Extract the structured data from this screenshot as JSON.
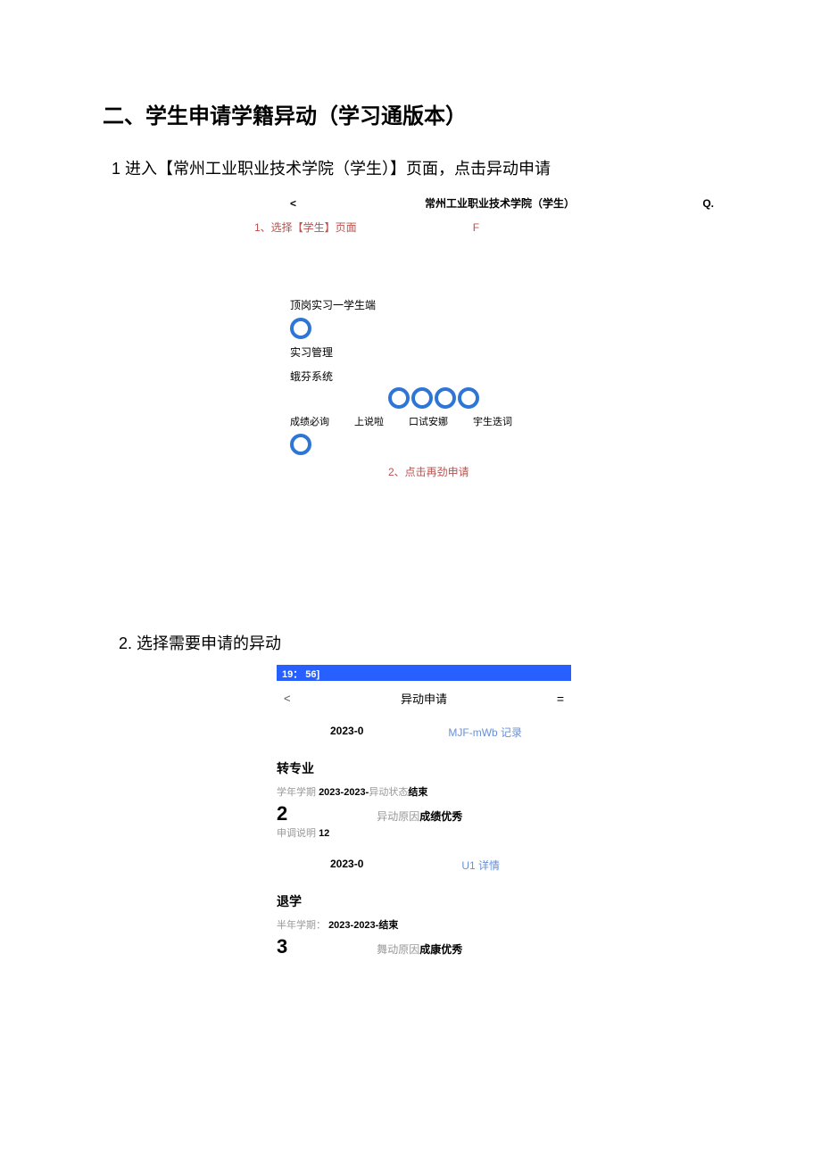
{
  "doc": {
    "heading": "二、学生申请学籍异动（学习通版本）",
    "step1": "1 进入【常州工业职业技术学院（学生）】页面，点击异动申请",
    "step2": "2. 选择需要申请的异动"
  },
  "screenshot1": {
    "back": "<",
    "title": "常州工业职业技术学院（学生）",
    "search": "Q.",
    "annot1": "1、选择【学生】页面",
    "annot1_extra": "F",
    "section_a": "顶岗实习一学生端",
    "label_a": "实习管理",
    "section_b": "蛾芬系统",
    "labels": [
      "成绩必询",
      "上说啦",
      "口试安娜",
      "宇生迭词"
    ],
    "annot2": "2、点击再劲申请"
  },
  "screenshot2": {
    "status_time": "19： 56]",
    "back": "<",
    "title": "异动申请",
    "menu": "=",
    "tab_left": "2023-0",
    "tab_right": "MJF-mWb 记录",
    "card1": {
      "title": "转专业",
      "term_label": "学年学期",
      "term_value": "2023-2023-",
      "state_label": "异动状态",
      "state_value": "结束",
      "big_num": "2",
      "reason_label": "异动原因",
      "reason_value": "成绩优秀",
      "desc_label": "申调说明",
      "desc_value": "12"
    },
    "footer1_left": "2023-0",
    "footer1_right": "U1 详情",
    "card2": {
      "title": "退学",
      "term_label": "半年学期：",
      "term_value": "2023-2023-结束",
      "big_num": "3",
      "reason_label": "舞动原因",
      "reason_value": "成康优秀"
    }
  }
}
